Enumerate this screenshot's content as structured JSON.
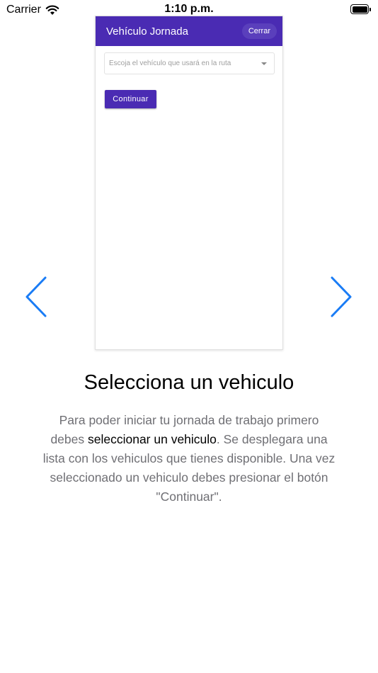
{
  "status_bar": {
    "carrier": "Carrier",
    "time": "1:10 p.m.",
    "wifi_icon": "wifi-icon",
    "battery_icon": "battery-icon",
    "battery_level": 1.0
  },
  "preview": {
    "app_title": "Vehículo Jornada",
    "close_label": "Cerrar",
    "select_placeholder": "Escoja el vehículo que usará en la ruta",
    "continue_label": "Continuar",
    "accent_color": "#4a2bb3"
  },
  "navigation": {
    "prev_icon": "chevron-left-icon",
    "next_icon": "chevron-right-icon",
    "chevron_color": "#1a7cf5"
  },
  "content": {
    "heading": "Selecciona un vehiculo",
    "desc_part1": "Para poder iniciar tu jornada de trabajo primero debes ",
    "desc_bold": "seleccionar un vehiculo",
    "desc_part2": ". Se desplegara una lista con los vehiculos que tienes disponible. Una vez seleccionado un vehiculo debes presionar el botón \"Continuar\"."
  }
}
